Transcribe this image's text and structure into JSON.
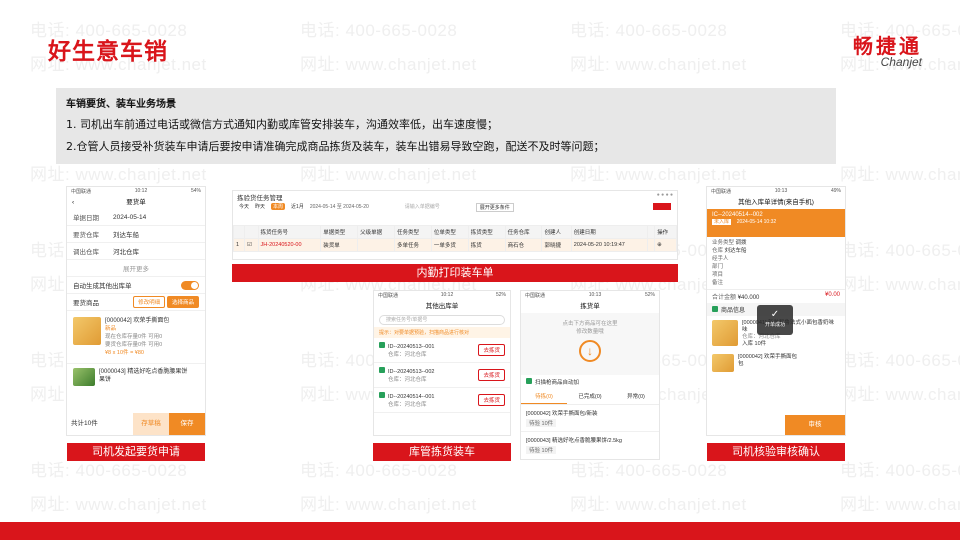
{
  "slide": {
    "title": "好生意车销",
    "watermark_phone": "电话: 400-665-0028",
    "watermark_site": "网址: www.chanjet.net",
    "logo_cn": "畅捷通",
    "logo_en": "Chanjet",
    "accent_color": "#d9151b"
  },
  "description": {
    "heading": "车销要货、装车业务场景",
    "line1": "1. 司机出车前通过电话或微信方式通知内勤或库管安排装车，沟通效率低，出车速度慢；",
    "line2": "2.仓管人员接受补货装车申请后要按申请准确完成商品拣货及装车，装车出错易导致空跑，配送不及时等问题；"
  },
  "captions": {
    "c1": "司机发起要货申请",
    "c2": "内勤打印装车单",
    "c3": "库管拣货装车",
    "c4": "司机核验审核确认"
  },
  "phone1": {
    "status_left": "中国联通",
    "status_time": "10:12",
    "status_right": "54%",
    "title": "要货单",
    "rows": [
      {
        "k": "单据日期",
        "v": "2024-05-14"
      },
      {
        "k": "要货仓库",
        "v": "刘达车船"
      },
      {
        "k": "调出仓库",
        "v": "河北仓库"
      }
    ],
    "expand": "展开更多",
    "auto_label": "自动生成其他出库单",
    "goods_label": "要货商品",
    "btn_modify": "修改明细",
    "btn_select": "选择商品",
    "item1_code": "[0000042] 欢荣手撕面包",
    "item1_tag": "新品",
    "item1_meta1": "现在仓库存量0件  可用0",
    "item1_meta2": "要货仓库存量0件  可用0",
    "item1_price": "¥8 x 10件 = ¥80",
    "item2_code": "[0000043] 精选好吃点香脆腰果饼",
    "item2_name": "果饼",
    "footer_total": "共计10件",
    "footer_btn1": "存草稿",
    "footer_btn2": "保存"
  },
  "desktop": {
    "title": "拣验货任务管理",
    "search_placeholder": "请输入单据编号",
    "tab_today": "今天",
    "tab_yesterday": "昨天",
    "tab_week": "本周",
    "tab_month": "近1月",
    "date_range": "2024-05-14 至 2024-05-20",
    "filter_more": "展开更多条件",
    "headers": [
      "",
      "",
      "拣货任务号",
      "单据类型",
      "父级单据",
      "任务类型",
      "位单类型",
      "拣货类型",
      "任务仓库",
      "创建人",
      "创建日期",
      "",
      "操作"
    ],
    "row": [
      "1",
      "☑",
      "JH-20240520-00",
      "装货单",
      "",
      "多单任务",
      "一单多货",
      "拣货",
      "商石仓",
      "郭晓捷",
      "2024-05-20 10:19:47",
      "",
      "⊕"
    ]
  },
  "phone2": {
    "status_left": "中国联通",
    "status_time": "10:12",
    "status_right": "52%",
    "title": "其他出库单",
    "search_placeholder": "搜索任务号/单据号",
    "tip": "提示：对要单据预验，扫描商品进行核对",
    "items": [
      {
        "id": "ID--20240513--001",
        "wh": "仓库：河北仓库",
        "btn": "去拣货"
      },
      {
        "id": "ID--20240513--002",
        "wh": "仓库：河北仓库",
        "btn": "去拣货"
      },
      {
        "id": "ID--20240514--001",
        "wh": "仓库：河北仓库",
        "btn": "去拣货"
      }
    ]
  },
  "phone3": {
    "status_left": "中国联通",
    "status_time": "10:13",
    "status_right": "52%",
    "title": "拣货单",
    "prompt1": "点击下方商品可在这里",
    "prompt2": "修改数量哦",
    "checkbox_label": "扫描枪商品自动加",
    "tab1": "待拣(0)",
    "tab2": "已完成(0)",
    "tab3": "异常(0)",
    "item1_name": "[0000042] 欢荣手撕面包/新装",
    "item1_count": "待验 10件",
    "item2_name": "[0000043] 精选好吃点香脆腰果饼/2.5kg",
    "item2_count": "待验 10件"
  },
  "phone4": {
    "status_left": "中国联通",
    "status_time": "10:13",
    "status_right": "49%",
    "title": "其他入库单详情(来自手机)",
    "doc_no": "IC--20240514--002",
    "doc_tag": "未入库",
    "doc_date": "2024-05-14 10:32",
    "f1k": "业务类型",
    "f1v": "调拨",
    "f2k": "仓库",
    "f2v": "刘达车船",
    "f3k": "经手人",
    "f4k": "部门",
    "f5k": "项目",
    "f6k": "备注",
    "amount": "¥40.000",
    "amount_prefix": "合计金额",
    "discount": "¥0.00",
    "goods_info": "商品信息",
    "item1_code": "[0000041] 新装和鲁法式小面包香奶味",
    "item1_name": "味",
    "item1_meta": "仓库：河北仓库",
    "item1_qty": "入库 10件",
    "item2_code": "[0000042] 欢荣手撕面包",
    "item2_name": "包",
    "popup_text": "开单成功",
    "footer_btn": "审核"
  }
}
